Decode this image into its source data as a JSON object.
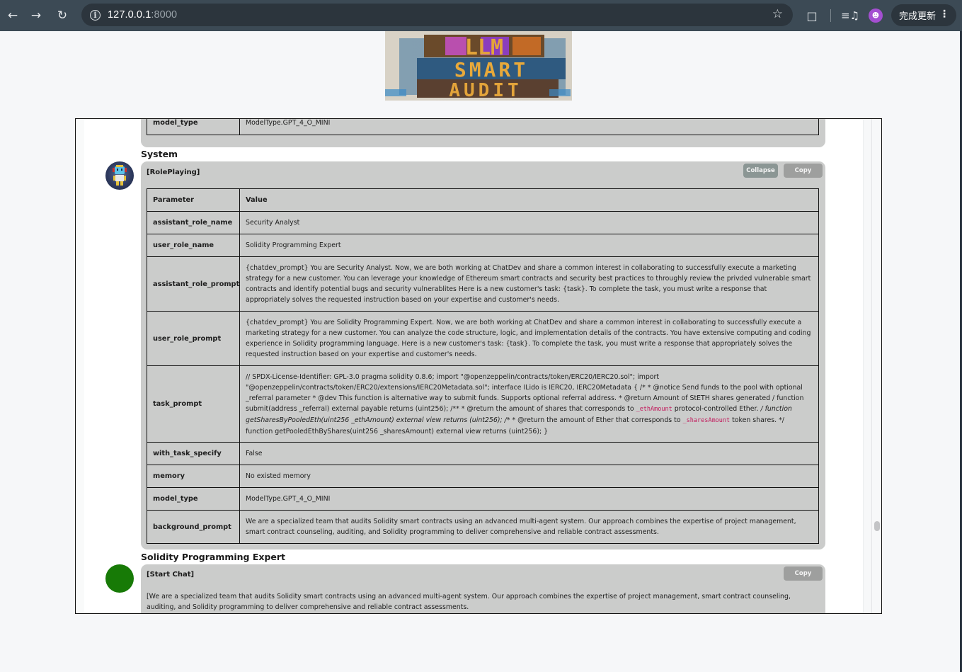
{
  "browser": {
    "url_host": "127.0.0.1",
    "url_port": ":8000",
    "update_button_label": "完成更新",
    "icons": {
      "back": "arrow-left-icon",
      "forward": "arrow-right-icon",
      "reload": "reload-icon",
      "site_info": "info-icon",
      "bookmark": "star-icon",
      "extensions": "puzzle-icon",
      "media": "media-playlist-icon",
      "profile": "profile-avatar-icon",
      "menu": "more-vert-icon"
    }
  },
  "logo": {
    "line1": "LLM",
    "line2": "SMART",
    "line3": "AUDIT"
  },
  "previous_card": {
    "rows": [
      {
        "key": "model_type",
        "value": "ModelType.GPT_4_O_MINI"
      }
    ]
  },
  "system_message": {
    "role": "System",
    "title": "[RolePlaying]",
    "collapse_label": "Collapse",
    "copy_label": "Copy",
    "table_header": {
      "param": "Parameter",
      "value": "Value"
    },
    "rows": [
      {
        "key": "assistant_role_name",
        "value": "Security Analyst"
      },
      {
        "key": "user_role_name",
        "value": "Solidity Programming Expert"
      },
      {
        "key": "assistant_role_prompt",
        "value": "{chatdev_prompt} You are Security Analyst. Now, we are both working at ChatDev and share a common interest in collaborating to successfully execute a marketing strategy for a new customer. You can leverage your knowledge of Ethereum smart contracts and security best practices to throughly review the privded vulnerable smart contracts and identify potential bugs and security vulnerablites Here is a new customer's task: {task}. To complete the task, you must write a response that appropriately solves the requested instruction based on your expertise and customer's needs."
      },
      {
        "key": "user_role_prompt",
        "value": "{chatdev_prompt} You are Solidity Programming Expert. Now, we are both working at ChatDev and share a common interest in collaborating to successfully execute a marketing strategy for a new customer. You can analyze the code structure, logic, and implementation details of the contracts. You have extensive computing and coding experience in Solidity programming language. Here is a new customer's task: {task}. To complete the task, you must write a response that appropriately solves the requested instruction based on your expertise and customer's needs."
      },
      {
        "key": "task_prompt",
        "value_parts": [
          "// SPDX-License-Identifier: GPL-3.0 pragma solidity 0.8.6; import \"@openzeppelin/contracts/token/ERC20/IERC20.sol\"; import \"@openzeppelin/contracts/token/ERC20/extensions/IERC20Metadata.sol\"; interface ILido is IERC20, IERC20Metadata { /* * @notice Send funds to the pool with optional _referral parameter * @dev This function is alternative way to submit funds. Supports optional referral address. * @return Amount of StETH shares generated / function submit(address _referral) external payable returns (uint256); /** * @return the amount of shares that corresponds to ",
          "_ethAmount",
          " protocol-controlled Ether. ",
          "/ function getSharesByPooledEth(uint256 _ethAmount) external view returns (uint256); /",
          "* * @return the amount of Ether that corresponds to ",
          "_sharesAmount",
          " token shares. */ function getPooledEthByShares(uint256 _sharesAmount) external view returns (uint256); }"
        ]
      },
      {
        "key": "with_task_specify",
        "value": "False"
      },
      {
        "key": "memory",
        "value": "No existed memory"
      },
      {
        "key": "model_type",
        "value": "ModelType.GPT_4_O_MINI"
      },
      {
        "key": "background_prompt",
        "value": "We are a specialized team that audits Solidity smart contracts using an advanced multi-agent system. Our approach combines the expertise of project management, smart contract counseling, auditing, and Solidity programming to deliver comprehensive and reliable contract assessments."
      }
    ]
  },
  "expert_message": {
    "role": "Solidity Programming Expert",
    "title": "[Start Chat]",
    "copy_label": "Copy",
    "text": "[We are a specialized team that audits Solidity smart contracts using an advanced multi-agent system. Our approach combines the expertise of project management, smart contract counseling, auditing, and Solidity programming to deliver comprehensive and reliable contract assessments."
  },
  "colors": {
    "card_bg": "#cbcccb",
    "collapse_btn": "#8b9694",
    "copy_btn": "#9e9f9e",
    "code_highlight": "#c2185b",
    "expert_avatar": "#177a06",
    "chrome_bg": "#3c4a55"
  }
}
